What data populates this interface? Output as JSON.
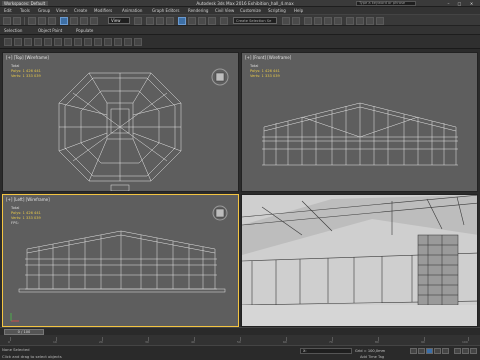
{
  "titlebar": {
    "workspace": "Workspaces: Default",
    "title": "Autodesk 3ds Max 2016     Exhibition_hall_4.max",
    "search_placeholder": "Type a keyword or phrase",
    "minimize": "–",
    "maximize": "□",
    "close": "✕"
  },
  "menu": [
    "Edit",
    "Tools",
    "Group",
    "Views",
    "Create",
    "Modifiers",
    "Animation",
    "Graph Editors",
    "Rendering",
    "Civil View",
    "Customize",
    "Scripting",
    "Help"
  ],
  "toolbar": {
    "view_value": "View",
    "selection_set": "Create Selection Se"
  },
  "ribbon": {
    "tabs": [
      "Selection",
      "Object Paint",
      "Populate"
    ]
  },
  "viewports": {
    "top": {
      "label": "[+] [Top] [Wireframe]",
      "total_label": "Total",
      "polys_label": "Polys:",
      "polys": "1 426 441",
      "verts_label": "Verts:",
      "verts": "1 333 039"
    },
    "front": {
      "label": "[+] [Front] [Wireframe]",
      "total_label": "Total",
      "polys_label": "Polys:",
      "polys": "1 426 441",
      "verts_label": "Verts:",
      "verts": "1 333 039"
    },
    "left": {
      "label": "[+] [Left] [Wireframe]",
      "total_label": "Total",
      "polys_label": "Polys:",
      "polys": "1 426 441",
      "verts_label": "Verts:",
      "verts": "1 333 039",
      "fps": "FPS:"
    },
    "perspective": {
      "label": ""
    }
  },
  "timeline": {
    "frame": "0 / 100"
  },
  "track": {
    "ticks": [
      "0",
      "10",
      "20",
      "30",
      "40",
      "50",
      "60",
      "70",
      "80",
      "90",
      "100"
    ]
  },
  "status": {
    "message": "Click and drag to select objects",
    "coord": "X:",
    "grid": "Grid = 100,0mm",
    "add_time": "Add Time Tag",
    "none_selected": "None Selected"
  },
  "colors": {
    "accent": "#3d6fa5",
    "active_viewport": "#f4c542",
    "stats": "#e8c94a"
  }
}
